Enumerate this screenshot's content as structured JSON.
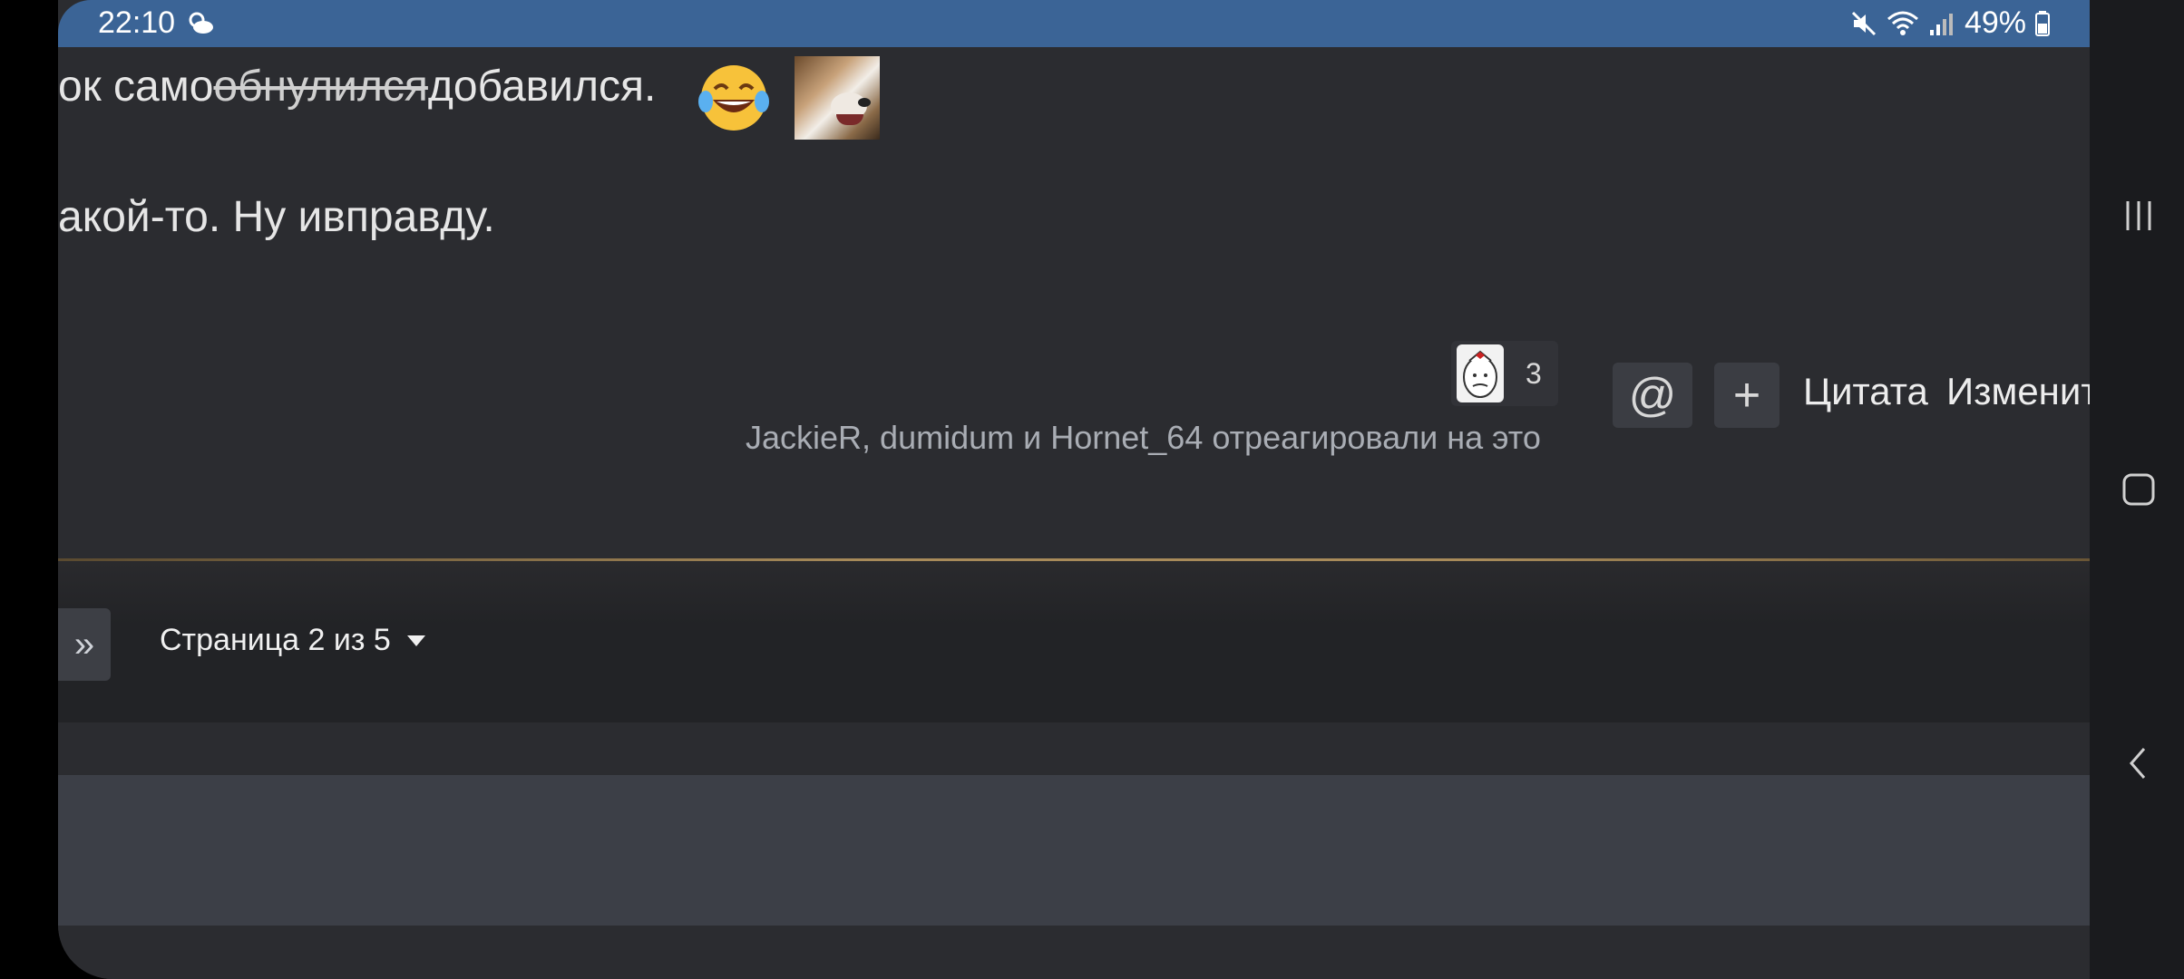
{
  "status_bar": {
    "time": "22:10",
    "battery": "49%",
    "background_color": "#3b6496"
  },
  "post": {
    "line1_before": "ок само",
    "line1_struck": "обнулился",
    "line1_after": "добавился.",
    "line2": "акой-то. Ну ивправду."
  },
  "reactions": {
    "count": "3",
    "reacted_by": "JackieR, dumidum и Hornet_64 отреагировали на это"
  },
  "actions": {
    "mention_label": "@",
    "plus_label": "+",
    "quote_label": "Цитата",
    "edit_label": "Изменит"
  },
  "pagination": {
    "last_label": "»",
    "page_label": "Страница 2 из 5"
  },
  "colors": {
    "page_bg": "#2b2c30",
    "separator": "#a88b5a",
    "reply_box": "#3c3f47"
  },
  "icons": [
    "weather-icon",
    "mute-icon",
    "wifi-icon",
    "signal-icon",
    "battery-icon",
    "laughing-emoji-icon",
    "dog-image",
    "recents-icon",
    "home-icon",
    "back-icon"
  ]
}
